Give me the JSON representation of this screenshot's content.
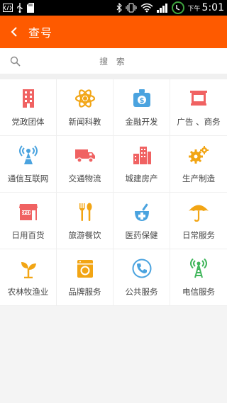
{
  "status_bar": {
    "ampm": "下午",
    "time": "5:01",
    "icons": [
      "code-icon",
      "usb-icon",
      "sd-card-icon",
      "bluetooth-icon",
      "vibrate-icon",
      "wifi-icon",
      "signal-icon",
      "clock-icon"
    ]
  },
  "app_bar": {
    "title": "查号",
    "back_icon": "back-arrow-icon",
    "color": "#fe5a00"
  },
  "search": {
    "placeholder": "搜 索"
  },
  "categories": [
    {
      "label": "党政团体",
      "icon": "building-icon",
      "color": "#f06262"
    },
    {
      "label": "新闻科教",
      "icon": "atom-icon",
      "color": "#f2a514"
    },
    {
      "label": "金融开发",
      "icon": "money-bag-icon",
      "color": "#4aa3df"
    },
    {
      "label": "广告 、商务",
      "icon": "billboard-icon",
      "color": "#f06262"
    },
    {
      "label": "通信互联网",
      "icon": "antenna-icon",
      "color": "#4aa3df"
    },
    {
      "label": "交通物流",
      "icon": "truck-icon",
      "color": "#f06262"
    },
    {
      "label": "城建房产",
      "icon": "city-icon",
      "color": "#f06262"
    },
    {
      "label": "生产制造",
      "icon": "gears-icon",
      "color": "#f2a514"
    },
    {
      "label": "日用百货",
      "icon": "shop-icon",
      "color": "#f06262"
    },
    {
      "label": "旅游餐饮",
      "icon": "fork-spoon-icon",
      "color": "#f2a514"
    },
    {
      "label": "医药保健",
      "icon": "medicine-icon",
      "color": "#4aa3df"
    },
    {
      "label": "日常服务",
      "icon": "umbrella-icon",
      "color": "#f2a514"
    },
    {
      "label": "农林牧渔业",
      "icon": "sprout-icon",
      "color": "#f2a514"
    },
    {
      "label": "品牌服务",
      "icon": "washer-icon",
      "color": "#f2a514"
    },
    {
      "label": "公共服务",
      "icon": "phone-icon",
      "color": "#4aa3df"
    },
    {
      "label": "电信服务",
      "icon": "tower-icon",
      "color": "#3fb55a"
    }
  ]
}
